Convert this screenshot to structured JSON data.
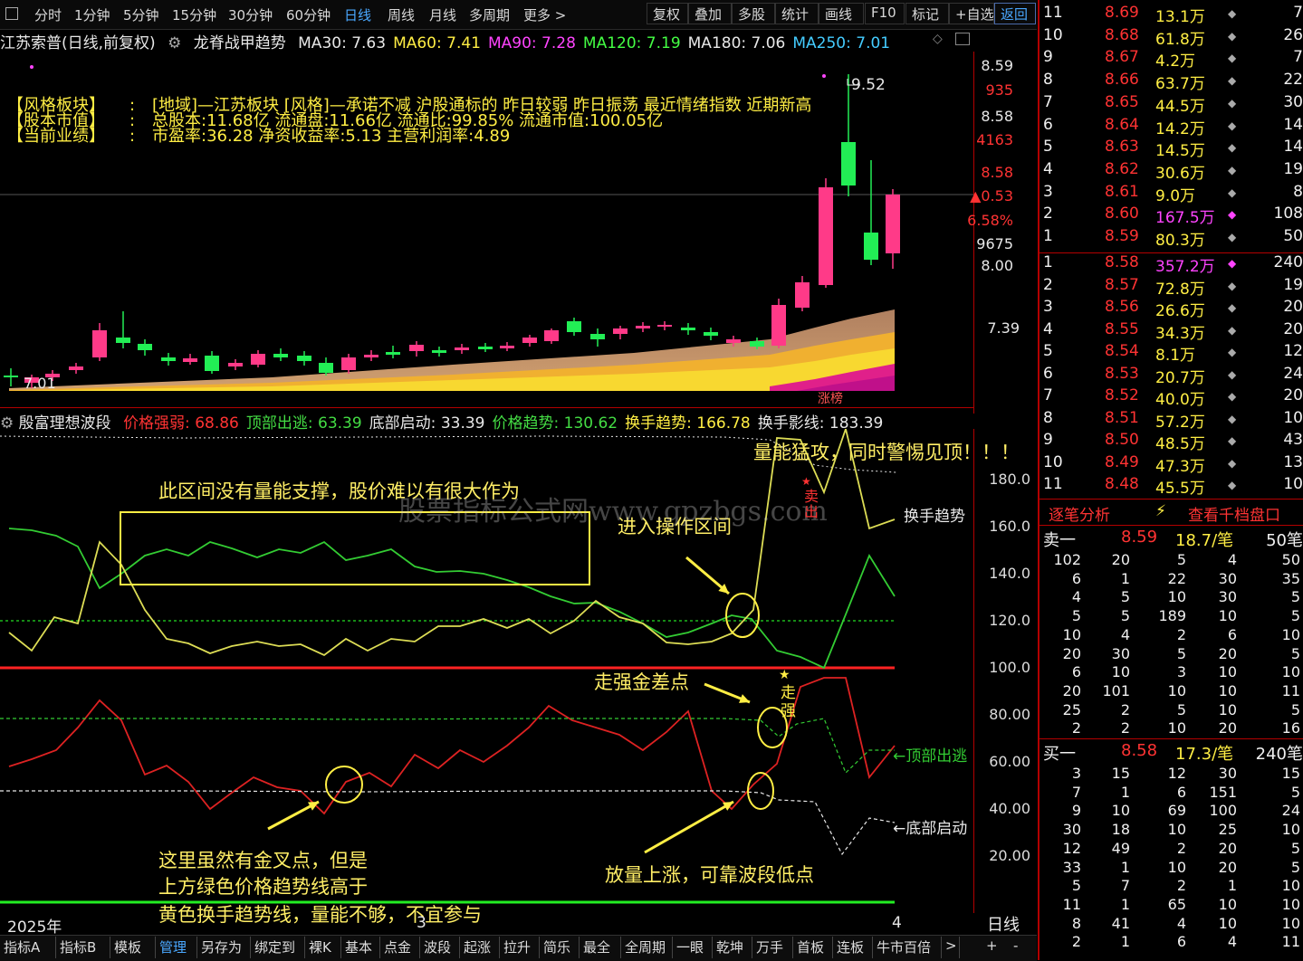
{
  "toolbar": {
    "left_items": [
      "分时",
      "1分钟",
      "5分钟",
      "15分钟",
      "30分钟",
      "60分钟",
      "日线",
      "周线",
      "月线",
      "多周期",
      "更多 >"
    ],
    "active_item": "日线",
    "right_items": [
      "复权",
      "叠加",
      "多股",
      "统计",
      "画线",
      "F10",
      "标记",
      "+自选",
      "返回"
    ],
    "active_right": "返回"
  },
  "header": {
    "stock_title": "江苏索普(日线,前复权)",
    "indicator_name": "龙脊战甲趋势",
    "ma": [
      {
        "label": "MA30: 7.63",
        "color": "#e8e8e8"
      },
      {
        "label": "MA60: 7.41",
        "color": "#ffee44"
      },
      {
        "label": "MA90: 7.28",
        "color": "#ff44ff"
      },
      {
        "label": "MA120: 7.19",
        "color": "#44ff44"
      },
      {
        "label": "MA180: 7.06",
        "color": "#e8e8e8"
      },
      {
        "label": "MA250: 7.01",
        "color": "#44ccff"
      }
    ]
  },
  "info": {
    "labels": [
      "【风格板块】",
      "【股本市值】",
      "【当前业绩】"
    ],
    "sep": ":",
    "lines": [
      "[地域]—江苏板块 [风格]—承诺不减 沪股通标的 昨日较弱 昨日振荡 最近情绪指数 近期新高",
      "总股本:11.68亿 流通盘:11.66亿 流通比:99.85% 流通市值:100.05亿",
      "市盈率:36.28 净资收益率:5.13 主营利润率:4.89"
    ]
  },
  "price_axis": {
    "labels": [
      "8.59",
      "935",
      "8.58",
      "4163",
      "8.58",
      "▲0.53",
      "6.58%",
      "9675",
      "8.00",
      "7.39"
    ],
    "colors": [
      "#e8e8e8",
      "#ff3333",
      "#e8e8e8",
      "#ff3333",
      "#ff3333",
      "#ff3333",
      "#ff3333",
      "#e8e8e8",
      "#e8e8e8",
      "#e8e8e8"
    ]
  },
  "price_annotations": {
    "high": "9.52",
    "low": "7.01",
    "limit_up": "涨榜"
  },
  "indicator": {
    "name": "殷富理想波段",
    "values": [
      {
        "label": "价格强弱: 68.86",
        "color": "#ff3333"
      },
      {
        "label": "顶部出逃: 63.39",
        "color": "#44dd44"
      },
      {
        "label": "底部启动: 33.39",
        "color": "#e8e8e8"
      },
      {
        "label": "价格趋势: 130.62",
        "color": "#44dd44"
      },
      {
        "label": "换手趋势: 166.78",
        "color": "#ffee44"
      },
      {
        "label": "换手影线: 183.39",
        "color": "#e8e8e8"
      }
    ],
    "axis": [
      "180.0",
      "160.0",
      "140.0",
      "120.0",
      "100.0",
      "80.00",
      "60.00",
      "40.00",
      "20.00"
    ],
    "side_labels": [
      "换手趋势",
      "←顶部出逃",
      "←底部启动"
    ]
  },
  "annotations": {
    "box_text": "此区间没有量能支撑，股价难以有很大作为",
    "enter": "进入操作区间",
    "surge": "量能猛攻，同时警惕见顶！！！",
    "strong_cross": "走强金差点",
    "volume_up": "放量上涨，可靠波段低点",
    "warn_line1": "这里虽然有金叉点，但是",
    "warn_line2": "上方绿色价格趋势线高于",
    "warn_line3": "黄色换手趋势线，量能不够，不宜参与",
    "watermark": "股票指标公式网www.gpzbgs.com",
    "sell_mark": "卖出",
    "walk_strong": "走强",
    "strong_top": "走强"
  },
  "timeline": {
    "year": "2025年",
    "month3": "3",
    "month4": "4",
    "period": "日线"
  },
  "tabs": [
    "指标A",
    "指标B",
    "模板",
    "管理",
    "另存为",
    "绑定到",
    "裸K",
    "基本",
    "点金",
    "波段",
    "起涨",
    "拉升",
    "简乐",
    "最全",
    "全周期",
    "一眼",
    "乾坤",
    "万手",
    "首板",
    "连板",
    "牛市百倍",
    ">"
  ],
  "active_tab": "管理",
  "order_book": {
    "sell": [
      {
        "lvl": "11",
        "price": "8.69",
        "vol": "13.1万",
        "n": "7"
      },
      {
        "lvl": "10",
        "price": "8.68",
        "vol": "61.8万",
        "n": "26"
      },
      {
        "lvl": "9",
        "price": "8.67",
        "vol": "4.2万",
        "n": "7"
      },
      {
        "lvl": "8",
        "price": "8.66",
        "vol": "63.7万",
        "n": "22"
      },
      {
        "lvl": "7",
        "price": "8.65",
        "vol": "44.5万",
        "n": "30"
      },
      {
        "lvl": "6",
        "price": "8.64",
        "vol": "14.2万",
        "n": "14"
      },
      {
        "lvl": "5",
        "price": "8.63",
        "vol": "14.5万",
        "n": "14"
      },
      {
        "lvl": "4",
        "price": "8.62",
        "vol": "30.6万",
        "n": "19"
      },
      {
        "lvl": "3",
        "price": "8.61",
        "vol": "9.0万",
        "n": "8"
      },
      {
        "lvl": "2",
        "price": "8.60",
        "vol": "167.5万",
        "n": "108"
      },
      {
        "lvl": "1",
        "price": "8.59",
        "vol": "80.3万",
        "n": "50"
      }
    ],
    "buy": [
      {
        "lvl": "1",
        "price": "8.58",
        "vol": "357.2万",
        "n": "240"
      },
      {
        "lvl": "2",
        "price": "8.57",
        "vol": "72.8万",
        "n": "19"
      },
      {
        "lvl": "3",
        "price": "8.56",
        "vol": "26.6万",
        "n": "20"
      },
      {
        "lvl": "4",
        "price": "8.55",
        "vol": "34.3万",
        "n": "20"
      },
      {
        "lvl": "5",
        "price": "8.54",
        "vol": "8.1万",
        "n": "12"
      },
      {
        "lvl": "6",
        "price": "8.53",
        "vol": "20.7万",
        "n": "24"
      },
      {
        "lvl": "7",
        "price": "8.52",
        "vol": "40.0万",
        "n": "20"
      },
      {
        "lvl": "8",
        "price": "8.51",
        "vol": "57.2万",
        "n": "10"
      },
      {
        "lvl": "9",
        "price": "8.50",
        "vol": "48.5万",
        "n": "43"
      },
      {
        "lvl": "10",
        "price": "8.49",
        "vol": "47.3万",
        "n": "13"
      },
      {
        "lvl": "11",
        "price": "8.48",
        "vol": "45.5万",
        "n": "10"
      }
    ],
    "tab_left": "逐笔分析",
    "tab_right": "查看千档盘口",
    "sell_one": {
      "label": "卖一",
      "price": "8.59",
      "per": "18.7/笔",
      "total": "50笔"
    },
    "buy_one": {
      "label": "买一",
      "price": "8.58",
      "per": "17.3/笔",
      "total": "240笔"
    },
    "sell_grid": [
      [
        "102",
        "20",
        "5",
        "4",
        "50"
      ],
      [
        "6",
        "1",
        "22",
        "30",
        "35"
      ],
      [
        "4",
        "5",
        "10",
        "30",
        "5"
      ],
      [
        "5",
        "5",
        "189",
        "10",
        "5"
      ],
      [
        "10",
        "4",
        "2",
        "6",
        "10"
      ],
      [
        "20",
        "30",
        "5",
        "20",
        "5"
      ],
      [
        "6",
        "10",
        "3",
        "10",
        "10"
      ],
      [
        "20",
        "101",
        "10",
        "10",
        "11"
      ],
      [
        "25",
        "2",
        "5",
        "10",
        "5"
      ],
      [
        "2",
        "2",
        "10",
        "20",
        "16"
      ]
    ],
    "buy_grid": [
      [
        "3",
        "15",
        "12",
        "30",
        "15"
      ],
      [
        "7",
        "1",
        "6",
        "151",
        "5"
      ],
      [
        "9",
        "10",
        "69",
        "100",
        "24"
      ],
      [
        "30",
        "18",
        "10",
        "25",
        "10"
      ],
      [
        "12",
        "49",
        "2",
        "20",
        "5"
      ],
      [
        "33",
        "1",
        "10",
        "20",
        "5"
      ],
      [
        "5",
        "7",
        "2",
        "1",
        "10"
      ],
      [
        "11",
        "1",
        "65",
        "10",
        "10"
      ],
      [
        "8",
        "41",
        "4",
        "10",
        "10"
      ],
      [
        "2",
        "1",
        "6",
        "4",
        "11"
      ]
    ]
  }
}
